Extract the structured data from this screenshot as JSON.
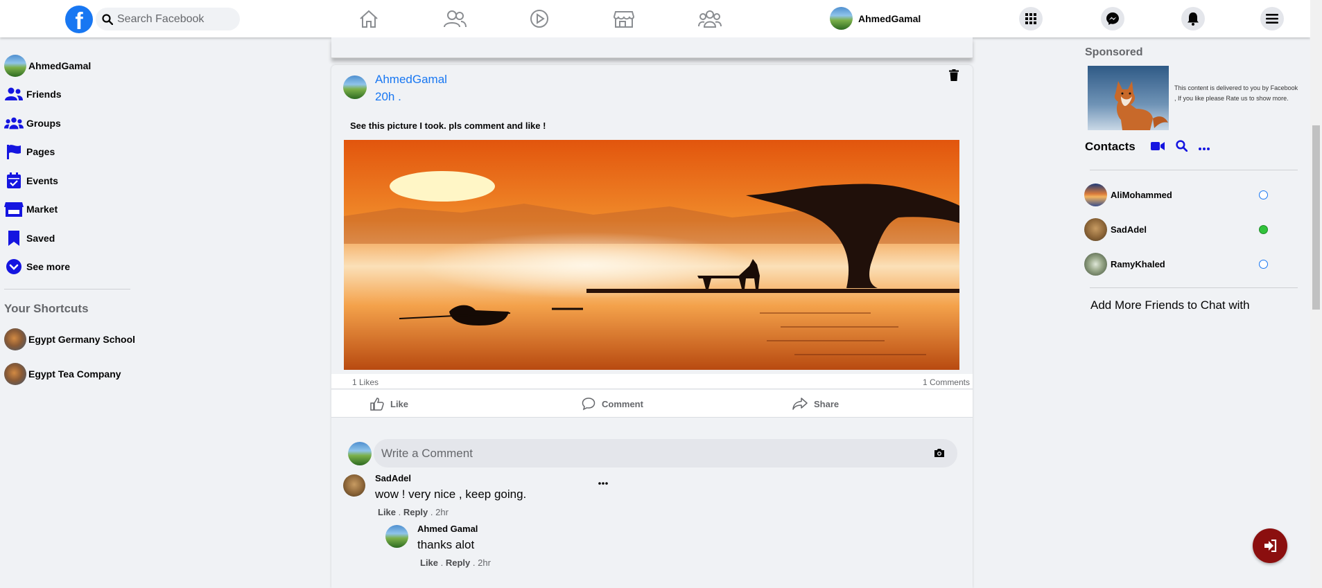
{
  "navbar": {
    "logo_letter": "f",
    "search_placeholder": "Search Facebook",
    "profile_name": "AhmedGamal",
    "nav_icons": [
      "home-icon",
      "friends-icon",
      "watch-icon",
      "marketplace-icon",
      "groups-icon"
    ],
    "right_buttons": [
      "menu-grid-icon",
      "messenger-icon",
      "notifications-icon",
      "hamburger-menu-icon"
    ],
    "accent": "#1877f2"
  },
  "left_sidebar": {
    "profile_name": "AhmedGamal",
    "items": [
      {
        "label": "Friends",
        "icon": "friends-icon"
      },
      {
        "label": "Groups",
        "icon": "groups-icon"
      },
      {
        "label": "Pages",
        "icon": "flag-icon"
      },
      {
        "label": "Events",
        "icon": "calendar-icon"
      },
      {
        "label": "Market",
        "icon": "store-icon"
      },
      {
        "label": "Saved",
        "icon": "bookmark-icon"
      },
      {
        "label": "See more",
        "icon": "chevron-down-icon"
      }
    ],
    "shortcuts_title": "Your Shortcuts",
    "shortcuts": [
      {
        "label": "Egypt Germany School"
      },
      {
        "label": "Egypt Tea Company"
      }
    ]
  },
  "post": {
    "author": "AhmedGamal",
    "time": "20h .",
    "text": "See this picture I took. pls comment and like !",
    "likes": "1 Likes",
    "comments_count": "1 Comments",
    "actions": {
      "like": "Like",
      "comment": "Comment",
      "share": "Share"
    },
    "comment_placeholder": "Write a Comment",
    "comments": [
      {
        "author": "SadAdel",
        "text": "wow ! very nice , keep going.",
        "like": "Like",
        "reply": "Reply",
        "time": "2hr",
        "replies": [
          {
            "author": "Ahmed Gamal",
            "text": "thanks alot",
            "like": "Like",
            "reply": "Reply",
            "time": "2hr"
          }
        ]
      }
    ]
  },
  "right_sidebar": {
    "sponsored_title": "Sponsored",
    "ad_text": "This content is delivered to you by Facebook , If you like please Rate us to show more.",
    "contacts_title": "Contacts",
    "contacts": [
      {
        "name": "AliMohammed",
        "online": false
      },
      {
        "name": "SadAdel",
        "online": true
      },
      {
        "name": "RamyKhaled",
        "online": false
      }
    ],
    "add_more": "Add More Friends to Chat with"
  },
  "colors": {
    "online": "#31c23b",
    "offline_ring": "#1877f2",
    "logout": "#8b0f0f",
    "sidebar_icons": "#1515e0"
  }
}
